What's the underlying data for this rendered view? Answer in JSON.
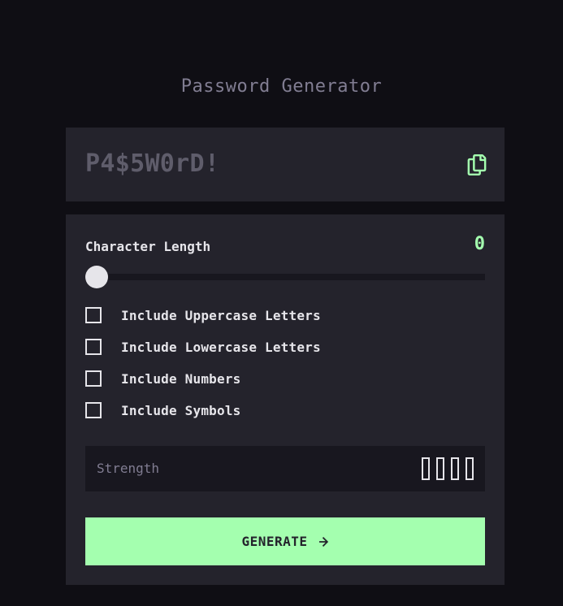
{
  "app": {
    "title": "Password Generator"
  },
  "output": {
    "password": "P4$5W0rD!",
    "copy_icon": "copy-icon"
  },
  "length": {
    "label": "Character Length",
    "value": "0",
    "slider_fraction": 0
  },
  "options": [
    {
      "label": "Include Uppercase Letters",
      "checked": false
    },
    {
      "label": "Include Lowercase Letters",
      "checked": false
    },
    {
      "label": "Include Numbers",
      "checked": false
    },
    {
      "label": "Include Symbols",
      "checked": false
    }
  ],
  "strength": {
    "label": "Strength",
    "level": 0,
    "bars_total": 4
  },
  "generate": {
    "label": "GENERATE",
    "icon": "arrow-right-icon"
  },
  "colors": {
    "background": "#0f0e14",
    "card": "#24232c",
    "accent": "#a4ffaf",
    "muted": "#817d92",
    "text": "#e6e5ea"
  }
}
